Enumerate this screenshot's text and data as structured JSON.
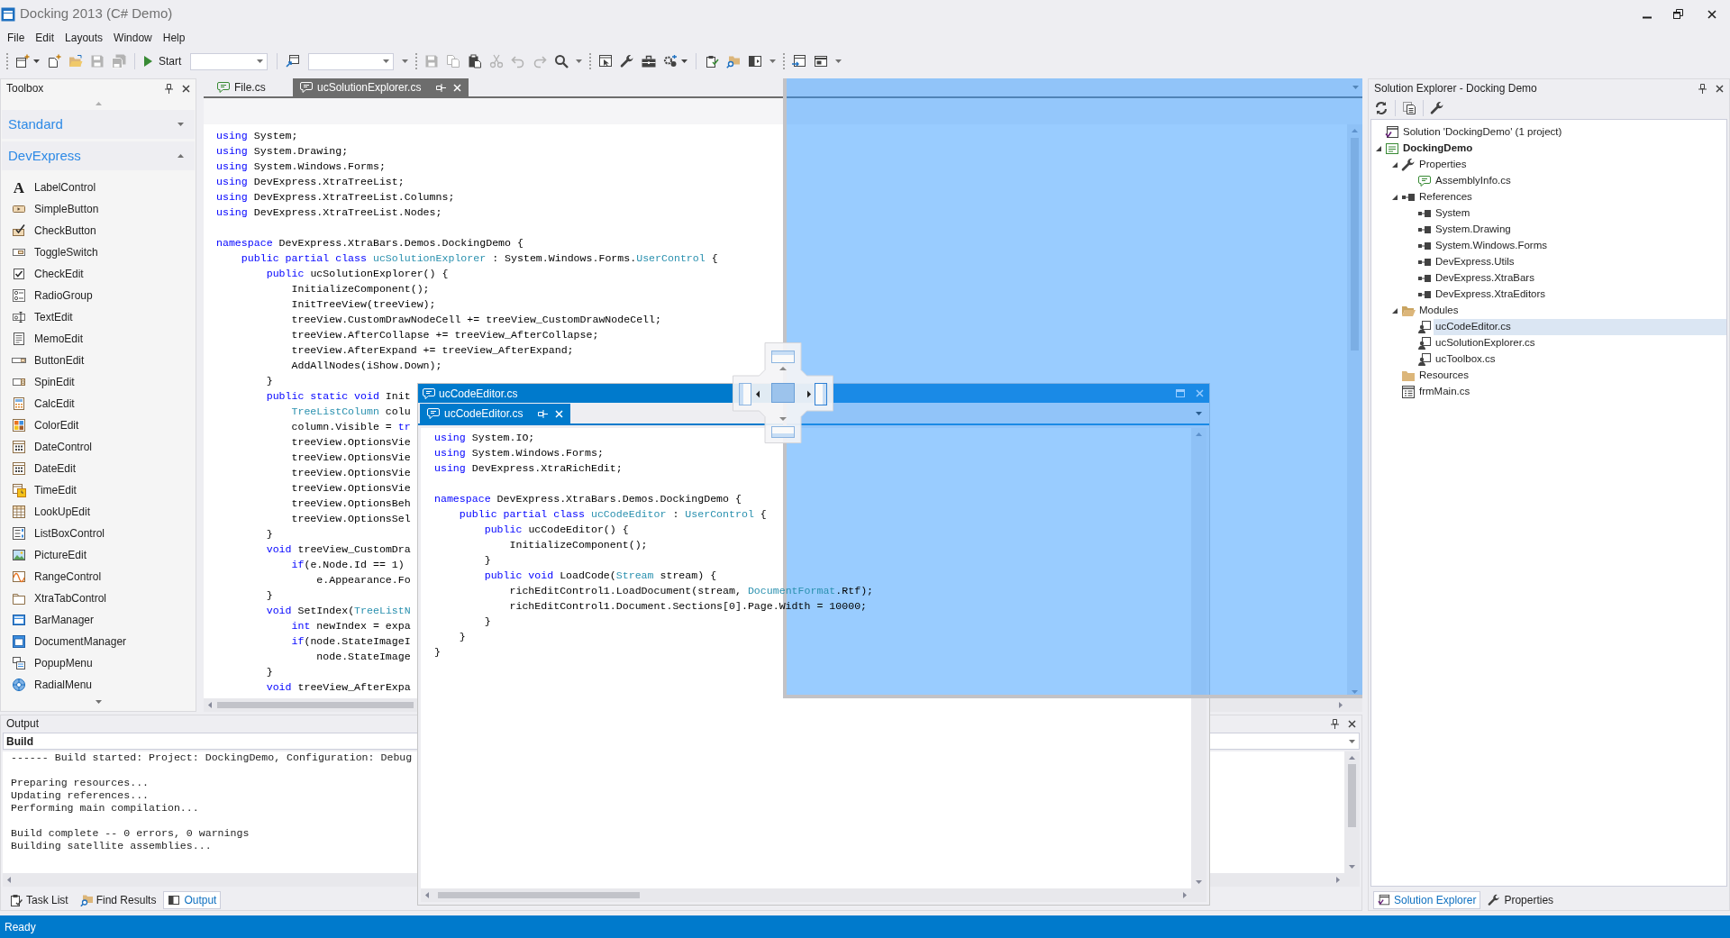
{
  "window": {
    "title": "Docking 2013 (C# Demo)"
  },
  "menu": [
    "File",
    "Edit",
    "Layouts",
    "Window",
    "Help"
  ],
  "toolbar": {
    "items": [
      {
        "kind": "grip"
      },
      {
        "kind": "split",
        "disabled": false
      },
      {
        "kind": "button",
        "disabled": false
      },
      {
        "kind": "button",
        "disabled": false
      },
      {
        "kind": "button",
        "disabled": true
      },
      {
        "kind": "button",
        "disabled": true
      },
      {
        "kind": "separator"
      },
      {
        "kind": "start",
        "label": "Start"
      },
      {
        "kind": "combo"
      },
      {
        "kind": "separator"
      },
      {
        "kind": "button",
        "disabled": false
      },
      {
        "kind": "combo"
      },
      {
        "kind": "overflow"
      },
      {
        "kind": "grip"
      },
      {
        "kind": "button",
        "disabled": true
      },
      {
        "kind": "button",
        "disabled": true
      },
      {
        "kind": "button",
        "disabled": false
      },
      {
        "kind": "button",
        "disabled": true
      },
      {
        "kind": "button",
        "disabled": true
      },
      {
        "kind": "button",
        "disabled": true
      },
      {
        "kind": "button",
        "disabled": false
      },
      {
        "kind": "overflow"
      },
      {
        "kind": "grip"
      },
      {
        "kind": "button",
        "disabled": false
      },
      {
        "kind": "button",
        "disabled": false
      },
      {
        "kind": "button",
        "disabled": false
      },
      {
        "kind": "split",
        "disabled": false
      },
      {
        "kind": "separator"
      },
      {
        "kind": "button",
        "disabled": false
      },
      {
        "kind": "button",
        "disabled": false
      },
      {
        "kind": "button",
        "disabled": false
      },
      {
        "kind": "overflow"
      },
      {
        "kind": "grip"
      },
      {
        "kind": "button",
        "disabled": false
      },
      {
        "kind": "button",
        "disabled": false
      },
      {
        "kind": "overflow"
      }
    ]
  },
  "toolbox": {
    "title": "Toolbox",
    "groups": [
      {
        "label": "Standard",
        "expanded": false
      },
      {
        "label": "DevExpress",
        "expanded": true,
        "items": [
          {
            "label": "LabelControl",
            "glyph": "A"
          },
          {
            "label": "SimpleButton"
          },
          {
            "label": "CheckButton"
          },
          {
            "label": "ToggleSwitch"
          },
          {
            "label": "CheckEdit"
          },
          {
            "label": "RadioGroup"
          },
          {
            "label": "TextEdit"
          },
          {
            "label": "MemoEdit"
          },
          {
            "label": "ButtonEdit"
          },
          {
            "label": "SpinEdit"
          },
          {
            "label": "CalcEdit"
          },
          {
            "label": "ColorEdit"
          },
          {
            "label": "DateControl"
          },
          {
            "label": "DateEdit"
          },
          {
            "label": "TimeEdit"
          },
          {
            "label": "LookUpEdit"
          },
          {
            "label": "ListBoxControl"
          },
          {
            "label": "PictureEdit"
          },
          {
            "label": "RangeControl"
          },
          {
            "label": "XtraTabControl"
          },
          {
            "label": "BarManager"
          },
          {
            "label": "DocumentManager"
          },
          {
            "label": "PopupMenu"
          },
          {
            "label": "RadialMenu"
          }
        ]
      }
    ]
  },
  "documents": {
    "tabs": [
      {
        "label": "File.cs",
        "selected": false
      },
      {
        "label": "ucSolutionExplorer.cs",
        "selected": true
      }
    ],
    "code": [
      {
        "lines": [
          {
            "tokens": [
              {
                "kind": "keyword",
                "text": "using"
              },
              {
                "kind": "plain",
                "text": " System;"
              }
            ]
          },
          {
            "tokens": [
              {
                "kind": "keyword",
                "text": "using"
              },
              {
                "kind": "plain",
                "text": " System.Drawing;"
              }
            ]
          },
          {
            "tokens": [
              {
                "kind": "keyword",
                "text": "using"
              },
              {
                "kind": "plain",
                "text": " System.Windows.Forms;"
              }
            ]
          },
          {
            "tokens": [
              {
                "kind": "keyword",
                "text": "using"
              },
              {
                "kind": "plain",
                "text": " DevExpress.XtraTreeList;"
              }
            ]
          },
          {
            "tokens": [
              {
                "kind": "keyword",
                "text": "using"
              },
              {
                "kind": "plain",
                "text": " DevExpress.XtraTreeList.Columns;"
              }
            ]
          },
          {
            "tokens": [
              {
                "kind": "keyword",
                "text": "using"
              },
              {
                "kind": "plain",
                "text": " DevExpress.XtraTreeList.Nodes;"
              }
            ]
          }
        ]
      },
      {
        "lines": [
          {
            "tokens": [
              {
                "kind": "keyword",
                "text": "namespace"
              },
              {
                "kind": "plain",
                "text": " DevExpress.XtraBars.Demos.DockingDemo {"
              }
            ]
          },
          {
            "tokens": [
              {
                "kind": "keyword",
                "text": "    public partial class"
              },
              {
                "kind": "type",
                "text": " ucSolutionExplorer"
              },
              {
                "kind": "plain",
                "text": " : System.Windows.Forms."
              },
              {
                "kind": "type",
                "text": "UserControl"
              },
              {
                "kind": "plain",
                "text": " {"
              }
            ]
          },
          {
            "tokens": [
              {
                "kind": "keyword",
                "text": "        public"
              },
              {
                "kind": "plain",
                "text": " ucSolutionExplorer() {"
              }
            ]
          },
          {
            "tokens": [
              {
                "kind": "plain",
                "text": "            InitializeComponent();"
              }
            ]
          },
          {
            "tokens": [
              {
                "kind": "plain",
                "text": "            InitTreeView(treeView);"
              }
            ]
          },
          {
            "tokens": [
              {
                "kind": "plain",
                "text": "            treeView.CustomDrawNodeCell += treeView_CustomDrawNodeCell;"
              }
            ]
          },
          {
            "tokens": [
              {
                "kind": "plain",
                "text": "            treeView.AfterCollapse += treeView_AfterCollapse;"
              }
            ]
          },
          {
            "tokens": [
              {
                "kind": "plain",
                "text": "            treeView.AfterExpand += treeView_AfterExpand;"
              }
            ]
          },
          {
            "tokens": [
              {
                "kind": "plain",
                "text": "            AddAllNodes(iShow.Down);"
              }
            ]
          },
          {
            "tokens": [
              {
                "kind": "plain",
                "text": "        }"
              }
            ]
          },
          {
            "tokens": [
              {
                "kind": "keyword",
                "text": "        public static void"
              },
              {
                "kind": "plain",
                "text": " Init"
              }
            ]
          },
          {
            "tokens": [
              {
                "kind": "type",
                "text": "            TreeListColumn"
              },
              {
                "kind": "plain",
                "text": " colu"
              }
            ]
          },
          {
            "tokens": [
              {
                "kind": "plain",
                "text": "            column.Visible = "
              },
              {
                "kind": "keyword",
                "text": "tr"
              }
            ]
          },
          {
            "tokens": [
              {
                "kind": "plain",
                "text": "            treeView.OptionsVie"
              }
            ]
          },
          {
            "tokens": [
              {
                "kind": "plain",
                "text": "            treeView.OptionsVie"
              }
            ]
          },
          {
            "tokens": [
              {
                "kind": "plain",
                "text": "            treeView.OptionsVie"
              }
            ]
          },
          {
            "tokens": [
              {
                "kind": "plain",
                "text": "            treeView.OptionsVie"
              }
            ]
          },
          {
            "tokens": [
              {
                "kind": "plain",
                "text": "            treeView.OptionsBeh"
              }
            ]
          },
          {
            "tokens": [
              {
                "kind": "plain",
                "text": "            treeView.OptionsSel"
              }
            ]
          },
          {
            "tokens": [
              {
                "kind": "plain",
                "text": "        }"
              }
            ]
          },
          {
            "tokens": [
              {
                "kind": "keyword",
                "text": "        void"
              },
              {
                "kind": "plain",
                "text": " treeView_CustomDra"
              }
            ]
          },
          {
            "tokens": [
              {
                "kind": "keyword",
                "text": "            if"
              },
              {
                "kind": "plain",
                "text": "(e.Node.Id == 1)"
              }
            ]
          },
          {
            "tokens": [
              {
                "kind": "plain",
                "text": "                e.Appearance.Fo"
              }
            ]
          },
          {
            "tokens": [
              {
                "kind": "plain",
                "text": "        }"
              }
            ]
          },
          {
            "tokens": [
              {
                "kind": "keyword",
                "text": "        void"
              },
              {
                "kind": "plain",
                "text": " SetIndex("
              },
              {
                "kind": "type",
                "text": "TreeListN"
              }
            ]
          },
          {
            "tokens": [
              {
                "kind": "keyword",
                "text": "            int"
              },
              {
                "kind": "plain",
                "text": " newIndex = expa"
              }
            ]
          },
          {
            "tokens": [
              {
                "kind": "keyword",
                "text": "            if"
              },
              {
                "kind": "plain",
                "text": "(node.StateImageI"
              }
            ]
          },
          {
            "tokens": [
              {
                "kind": "plain",
                "text": "                node.StateImage"
              }
            ]
          },
          {
            "tokens": [
              {
                "kind": "plain",
                "text": "        }"
              }
            ]
          },
          {
            "tokens": [
              {
                "kind": "keyword",
                "text": "        void"
              },
              {
                "kind": "plain",
                "text": " treeView_AfterExpa"
              }
            ]
          }
        ]
      }
    ]
  },
  "solution_explorer": {
    "title": "Solution Explorer - Docking Demo",
    "tree": [
      {
        "label": "Solution 'DockingDemo' (1 project)",
        "kind": "solution",
        "selected": false
      },
      {
        "label": "DockingDemo",
        "kind": "project",
        "selected": false,
        "expanded": true,
        "children": [
          {
            "label": "Properties",
            "kind": "properties",
            "selected": false,
            "expanded": true,
            "children": [
              {
                "label": "AssemblyInfo.cs",
                "kind": "code",
                "selected": false
              }
            ]
          },
          {
            "label": "References",
            "kind": "reference",
            "selected": false,
            "expanded": true,
            "children": [
              {
                "label": "System",
                "kind": "reference",
                "selected": false
              },
              {
                "label": "System.Drawing",
                "kind": "reference",
                "selected": false
              },
              {
                "label": "System.Windows.Forms",
                "kind": "reference",
                "selected": false
              },
              {
                "label": "DevExpress.Utils",
                "kind": "reference",
                "selected": false
              },
              {
                "label": "DevExpress.XtraBars",
                "kind": "reference",
                "selected": false
              },
              {
                "label": "DevExpress.XtraEditors",
                "kind": "reference",
                "selected": false
              }
            ]
          },
          {
            "label": "Modules",
            "kind": "folder",
            "selected": false,
            "expanded": true,
            "children": [
              {
                "label": "ucCodeEditor.cs",
                "kind": "usercontrol",
                "selected": true
              },
              {
                "label": "ucSolutionExplorer.cs",
                "kind": "usercontrol",
                "selected": false
              },
              {
                "label": "ucToolbox.cs",
                "kind": "usercontrol",
                "selected": false
              }
            ]
          },
          {
            "label": "Resources",
            "kind": "folder",
            "selected": false
          },
          {
            "label": "frmMain.cs",
            "kind": "form",
            "selected": false
          }
        ]
      }
    ],
    "tabs": [
      {
        "label": "Solution Explorer",
        "selected": true
      },
      {
        "label": "Properties",
        "selected": false
      }
    ]
  },
  "floating_window": {
    "title": "ucCodeEditor.cs",
    "tabs": [
      {
        "label": "ucCodeEditor.cs",
        "selected": true
      }
    ],
    "code": [
      {
        "lines": [
          {
            "tokens": [
              {
                "kind": "keyword",
                "text": "using"
              },
              {
                "kind": "plain",
                "text": " System.IO;"
              }
            ]
          },
          {
            "tokens": [
              {
                "kind": "keyword",
                "text": "using"
              },
              {
                "kind": "plain",
                "text": " System.Windows.Forms;"
              }
            ]
          },
          {
            "tokens": [
              {
                "kind": "keyword",
                "text": "using"
              },
              {
                "kind": "plain",
                "text": " DevExpress.XtraRichEdit;"
              }
            ]
          }
        ]
      },
      {
        "lines": [
          {
            "tokens": [
              {
                "kind": "keyword",
                "text": "namespace"
              },
              {
                "kind": "plain",
                "text": " DevExpress.XtraBars.Demos.DockingDemo {"
              }
            ]
          },
          {
            "tokens": [
              {
                "kind": "keyword",
                "text": "    public partial class"
              },
              {
                "kind": "type",
                "text": " ucCodeEditor"
              },
              {
                "kind": "plain",
                "text": " : "
              },
              {
                "kind": "type",
                "text": "UserControl"
              },
              {
                "kind": "plain",
                "text": " {"
              }
            ]
          },
          {
            "tokens": [
              {
                "kind": "keyword",
                "text": "        public"
              },
              {
                "kind": "plain",
                "text": " ucCodeEditor() {"
              }
            ]
          },
          {
            "tokens": [
              {
                "kind": "plain",
                "text": "            InitializeComponent();"
              }
            ]
          },
          {
            "tokens": [
              {
                "kind": "plain",
                "text": "        }"
              }
            ]
          },
          {
            "tokens": [
              {
                "kind": "keyword",
                "text": "        public void"
              },
              {
                "kind": "plain",
                "text": " LoadCode("
              },
              {
                "kind": "type",
                "text": "Stream"
              },
              {
                "kind": "plain",
                "text": " stream) {"
              }
            ]
          },
          {
            "tokens": [
              {
                "kind": "plain",
                "text": "            richEditControl1.LoadDocument(stream, "
              },
              {
                "kind": "type",
                "text": "DocumentFormat"
              },
              {
                "kind": "plain",
                "text": ".Rtf);"
              }
            ]
          },
          {
            "tokens": [
              {
                "kind": "plain",
                "text": "            richEditControl1.Document.Sections[0].Page.Width = 10000;"
              }
            ]
          },
          {
            "tokens": [
              {
                "kind": "plain",
                "text": "        }"
              }
            ]
          },
          {
            "tokens": [
              {
                "kind": "plain",
                "text": "    }"
              }
            ]
          },
          {
            "tokens": [
              {
                "kind": "plain",
                "text": "}"
              }
            ]
          }
        ]
      }
    ]
  },
  "output": {
    "title": "Output",
    "source": "Build",
    "paragraphs": [
      [
        "------ Build started: Project: DockingDemo, Configuration: Debug"
      ],
      [
        "Preparing resources...",
        "Updating references...",
        "Performing main compilation..."
      ],
      [
        "Build complete -- 0 errors, 0 warnings",
        "Building satellite assemblies..."
      ]
    ],
    "tabs": [
      {
        "label": "Task List",
        "selected": false
      },
      {
        "label": "Find Results",
        "selected": false
      },
      {
        "label": "Output",
        "selected": true
      }
    ]
  },
  "status_bar": {
    "text": "Ready"
  }
}
